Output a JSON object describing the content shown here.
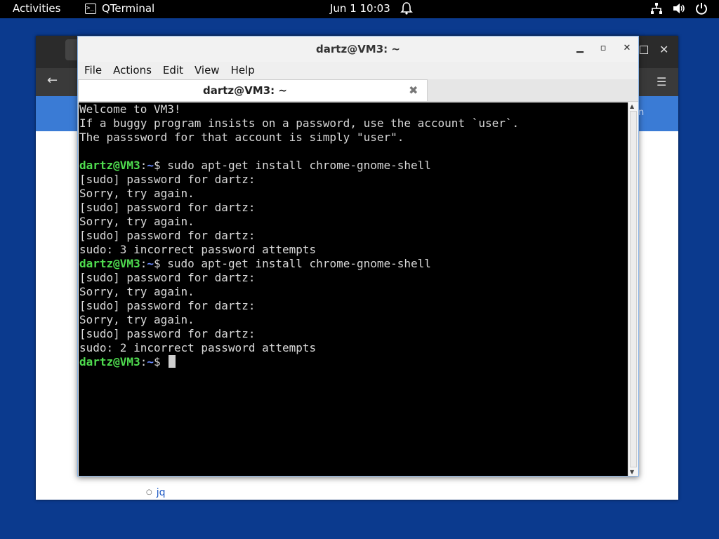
{
  "topbar": {
    "activities": "Activities",
    "app_name": "QTerminal",
    "clock": "Jun 1  10:03"
  },
  "browser": {
    "list_item": "jq",
    "peek_text": "n"
  },
  "qterminal": {
    "window_title": "dartz@VM3: ~",
    "menu": [
      "File",
      "Actions",
      "Edit",
      "View",
      "Help"
    ],
    "tab_title": "dartz@VM3: ~",
    "lines": [
      {
        "text": "Welcome to VM3!"
      },
      {
        "text": "If a buggy program insists on a password, use the account `user`."
      },
      {
        "text": "The passsword for that account is simply \"user\"."
      },
      {
        "text": ""
      },
      {
        "user": "dartz@VM3",
        "path": "~",
        "cmd": "$ sudo apt-get install chrome-gnome-shell"
      },
      {
        "text": "[sudo] password for dartz:"
      },
      {
        "text": "Sorry, try again."
      },
      {
        "text": "[sudo] password for dartz:"
      },
      {
        "text": "Sorry, try again."
      },
      {
        "text": "[sudo] password for dartz:"
      },
      {
        "text": "sudo: 3 incorrect password attempts"
      },
      {
        "user": "dartz@VM3",
        "path": "~",
        "cmd": "$ sudo apt-get install chrome-gnome-shell"
      },
      {
        "text": "[sudo] password for dartz:"
      },
      {
        "text": "Sorry, try again."
      },
      {
        "text": "[sudo] password for dartz:"
      },
      {
        "text": "Sorry, try again."
      },
      {
        "text": "[sudo] password for dartz:"
      },
      {
        "text": "sudo: 2 incorrect password attempts"
      },
      {
        "user": "dartz@VM3",
        "path": "~",
        "cmd": "$ ",
        "cursor": true
      }
    ]
  },
  "colors": {
    "desktop": "#0b3a8e",
    "prompt_user": "#4fdc4f",
    "prompt_path": "#6a8bff",
    "terminal_bg": "#000000",
    "terminal_fg": "#d8d8d8"
  }
}
